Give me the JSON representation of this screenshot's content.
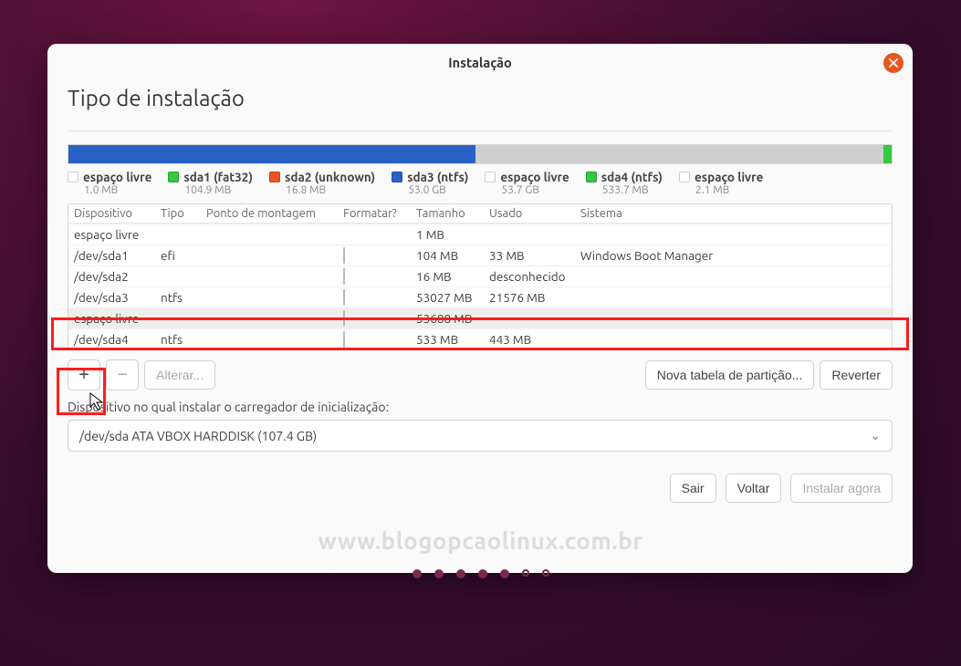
{
  "window": {
    "title": "Instalação"
  },
  "page": {
    "title": "Tipo de instalação"
  },
  "legend": [
    {
      "label": "espaço livre",
      "size": "1.0 MB",
      "color": "#ffffff"
    },
    {
      "label": "sda1 (fat32)",
      "size": "104.9 MB",
      "color": "#34c940"
    },
    {
      "label": "sda2 (unknown)",
      "size": "16.8 MB",
      "color": "#e95420"
    },
    {
      "label": "sda3 (ntfs)",
      "size": "53.0 GB",
      "color": "#2a61c4"
    },
    {
      "label": "espaço livre",
      "size": "53.7 GB",
      "color": "#ffffff"
    },
    {
      "label": "sda4 (ntfs)",
      "size": "533.7 MB",
      "color": "#34c940"
    },
    {
      "label": "espaço livre",
      "size": "2.1 MB",
      "color": "#ffffff"
    }
  ],
  "diskbar": [
    {
      "color": "#2a61c4",
      "width": "49.5%"
    },
    {
      "color": "#cfcfcf",
      "width": "49.5%"
    },
    {
      "color": "#34c940",
      "width": "1%"
    }
  ],
  "columns": {
    "device": "Dispositivo",
    "type": "Tipo",
    "mount": "Ponto de montagem",
    "format": "Formatar?",
    "size": "Tamanho",
    "used": "Usado",
    "system": "Sistema"
  },
  "rows": [
    {
      "device": "espaço livre",
      "type": "",
      "mount": "",
      "fmt": false,
      "size": "1 MB",
      "used": "",
      "system": ""
    },
    {
      "device": "/dev/sda1",
      "type": "efi",
      "mount": "",
      "fmt": true,
      "size": "104 MB",
      "used": "33 MB",
      "system": "Windows Boot Manager"
    },
    {
      "device": "/dev/sda2",
      "type": "",
      "mount": "",
      "fmt": true,
      "size": "16 MB",
      "used": "desconhecido",
      "system": ""
    },
    {
      "device": "/dev/sda3",
      "type": "ntfs",
      "mount": "",
      "fmt": true,
      "size": "53027 MB",
      "used": "21576 MB",
      "system": ""
    },
    {
      "device": "espaço livre",
      "type": "",
      "mount": "",
      "fmt": true,
      "size": "53688 MB",
      "used": "",
      "system": "",
      "selected": true
    },
    {
      "device": "/dev/sda4",
      "type": "ntfs",
      "mount": "",
      "fmt": true,
      "size": "533 MB",
      "used": "443 MB",
      "system": ""
    }
  ],
  "toolbar": {
    "add": "+",
    "remove": "−",
    "change": "Alterar...",
    "newtable": "Nova tabela de partição...",
    "revert": "Reverter"
  },
  "bootloader": {
    "label": "Dispositivo no qual instalar o carregador de inicialização:",
    "value": "/dev/sda   ATA VBOX HARDDISK (107.4 GB)"
  },
  "footer": {
    "quit": "Sair",
    "back": "Voltar",
    "install": "Instalar agora"
  },
  "watermark": "www.blogopcaolinux.com.br",
  "progress": {
    "total": 7,
    "done": 5
  }
}
